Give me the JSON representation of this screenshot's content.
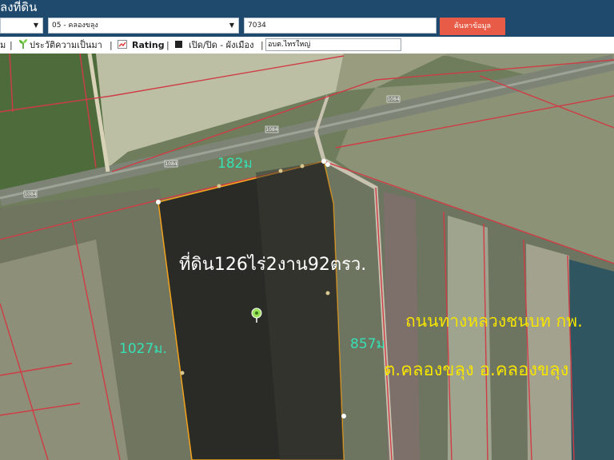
{
  "header": {
    "title": "ลงที่ดิน",
    "province_value": "",
    "district_value": "05 - คลองขลุง",
    "parcel_value": "7034",
    "search_button": "ค้นหาข้อมูล"
  },
  "toolbar": {
    "item_partial": "ม",
    "history": "ประวัติความเป็นมา",
    "rating": "Rating",
    "toggle_plan": "เปิด/ปิด - ผังเมือง",
    "text_field": "อบต.ไทรใหญ่"
  },
  "map": {
    "road_codes": [
      "1084",
      "1084",
      "1084",
      "1084"
    ],
    "top_width": "182ม",
    "left_length": "1027ม.",
    "right_length": "857ม",
    "area": "ที่ดิน126ไร่2งาน92ตรว.",
    "road_line": "ถนนทางหลวงชนบท กพ.",
    "location_line": "ต.คลองขลุง อ.คลองขลุง"
  },
  "colors": {
    "header": "#1f4a6e",
    "search_button": "#e85b46",
    "parcel_fill": "#2a2b27",
    "parcel_outline": "#f2a21b",
    "measure_text": "#36e0b5",
    "area_text": "#ffffff",
    "address_text": "#f5e400",
    "boundary": "#cf3c45"
  }
}
